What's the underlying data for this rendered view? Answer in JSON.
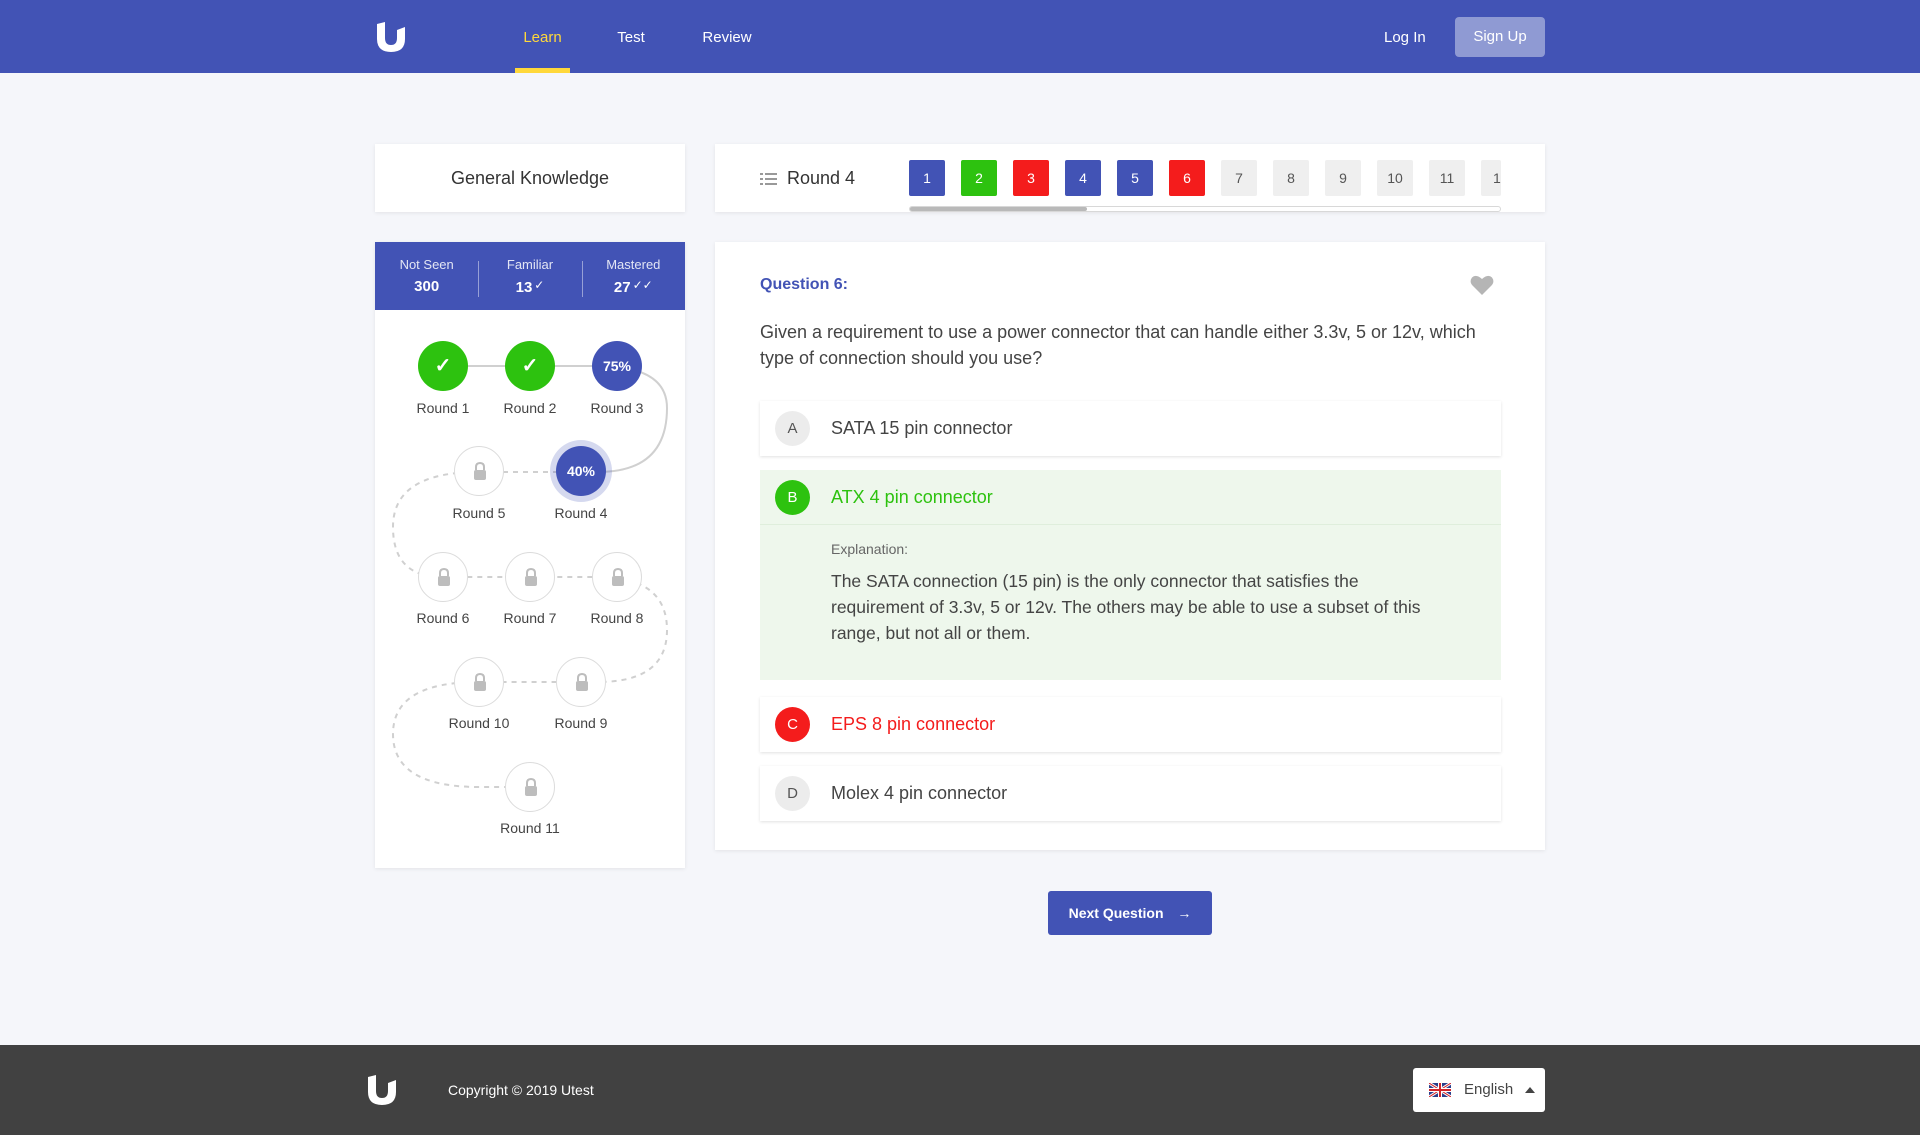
{
  "header": {
    "nav": [
      "Learn",
      "Test",
      "Review"
    ],
    "login": "Log In",
    "signup": "Sign Up",
    "accent": "#4253b5",
    "active_color": "#ffd83a"
  },
  "sidebar": {
    "topic": "General Knowledge",
    "stats": [
      {
        "label": "Not Seen",
        "value": "300"
      },
      {
        "label": "Familiar",
        "value": "13"
      },
      {
        "label": "Mastered",
        "value": "27"
      }
    ],
    "rounds": [
      {
        "label": "Round 1",
        "status": "done"
      },
      {
        "label": "Round 2",
        "status": "done"
      },
      {
        "label": "Round 3",
        "status": "progress",
        "text": "75%"
      },
      {
        "label": "Round 4",
        "status": "current",
        "text": "40%"
      },
      {
        "label": "Round 5",
        "status": "locked"
      },
      {
        "label": "Round 6",
        "status": "locked"
      },
      {
        "label": "Round 7",
        "status": "locked"
      },
      {
        "label": "Round 8",
        "status": "locked"
      },
      {
        "label": "Round 9",
        "status": "locked"
      },
      {
        "label": "Round 10",
        "status": "locked"
      },
      {
        "label": "Round 11",
        "status": "locked"
      }
    ]
  },
  "round_selector": {
    "title": "Round 4",
    "questions": [
      "1",
      "2",
      "3",
      "4",
      "5",
      "6",
      "7",
      "8",
      "9",
      "10",
      "11",
      "1"
    ]
  },
  "question": {
    "label": "Question 6:",
    "text": "Given a requirement to use a power connector that can handle either 3.3v, 5 or 12v, which type of connection should you use?",
    "answers": [
      {
        "letter": "A",
        "text": "SATA 15 pin connector"
      },
      {
        "letter": "B",
        "text": "ATX 4 pin connector"
      },
      {
        "letter": "C",
        "text": "EPS 8 pin connector"
      },
      {
        "letter": "D",
        "text": "Molex 4 pin connector"
      }
    ],
    "explanation_label": "Explanation:",
    "explanation": "The SATA connection (15 pin) is the only connector that satisfies the requirement of 3.3v, 5 or 12v. The others may be able to use a subset of this range, but not all or them."
  },
  "next_button": "Next Question",
  "footer": {
    "copyright": "Copyright © 2019 Utest",
    "language": "English"
  }
}
